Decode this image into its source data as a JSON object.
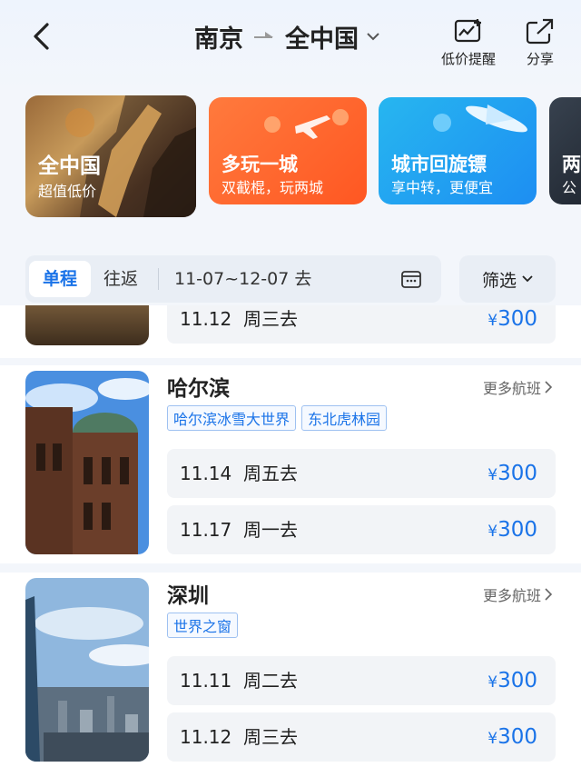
{
  "header": {
    "origin": "南京",
    "destination": "全中国",
    "actions": [
      {
        "label": "低价提醒",
        "icon": "price-alert-icon"
      },
      {
        "label": "分享",
        "icon": "share-icon"
      }
    ]
  },
  "promo_cards": [
    {
      "title": "全中国",
      "subtitle": "超值低价"
    },
    {
      "title": "多玩一城",
      "subtitle": "双截棍，玩两城"
    },
    {
      "title": "城市回旋镖",
      "subtitle": "享中转，更便宜"
    },
    {
      "title": "两",
      "subtitle": "公"
    }
  ],
  "filters": {
    "one_way": "单程",
    "round_trip": "往返",
    "date_range": "11-07~12-07 去",
    "filter_button": "筛选"
  },
  "partial_flight": {
    "date": "11.12",
    "weekday": "周三去",
    "currency": "¥",
    "price": "300"
  },
  "destinations": [
    {
      "city": "哈尔滨",
      "more": "更多航班",
      "tags": [
        "哈尔滨冰雪大世界",
        "东北虎林园"
      ],
      "flights": [
        {
          "date": "11.14",
          "weekday": "周五去",
          "currency": "¥",
          "price": "300"
        },
        {
          "date": "11.17",
          "weekday": "周一去",
          "currency": "¥",
          "price": "300"
        }
      ]
    },
    {
      "city": "深圳",
      "more": "更多航班",
      "tags": [
        "世界之窗"
      ],
      "flights": [
        {
          "date": "11.11",
          "weekday": "周二去",
          "currency": "¥",
          "price": "300"
        },
        {
          "date": "11.12",
          "weekday": "周三去",
          "currency": "¥",
          "price": "300"
        }
      ]
    }
  ],
  "colors": {
    "accent": "#1a73e8",
    "orange": "#ff5722",
    "sky": "#1d8ef2"
  }
}
